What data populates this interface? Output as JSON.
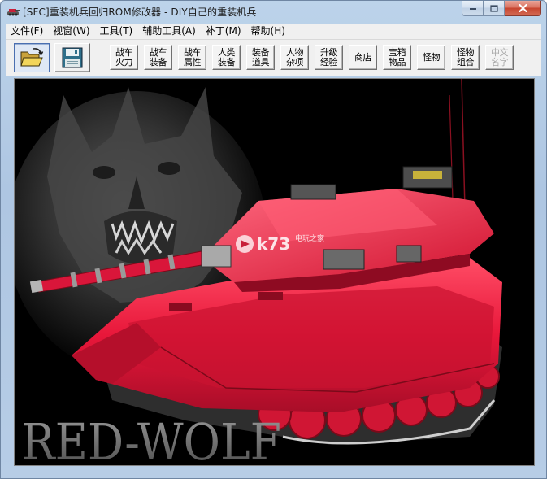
{
  "window": {
    "title": "[SFC]重装机兵回归ROM修改器 - DIY自己的重装机兵"
  },
  "menu": [
    {
      "label": "文件(F)"
    },
    {
      "label": "视窗(W)"
    },
    {
      "label": "工具(T)"
    },
    {
      "label": "辅助工具(A)"
    },
    {
      "label": "补丁(M)"
    },
    {
      "label": "帮助(H)"
    }
  ],
  "toolbar": {
    "open_icon": "folder-open-icon",
    "save_icon": "floppy-save-icon",
    "buttons": [
      {
        "line1": "战车",
        "line2": "火力",
        "enabled": true
      },
      {
        "line1": "战车",
        "line2": "装备",
        "enabled": true
      },
      {
        "line1": "战车",
        "line2": "属性",
        "enabled": true
      },
      {
        "line1": "人类",
        "line2": "装备",
        "enabled": true
      },
      {
        "line1": "装备",
        "line2": "道具",
        "enabled": true
      },
      {
        "line1": "人物",
        "line2": "杂项",
        "enabled": true
      },
      {
        "line1": "升级",
        "line2": "经验",
        "enabled": true
      },
      {
        "line1": "商店",
        "line2": "",
        "enabled": true
      },
      {
        "line1": "宝箱",
        "line2": "物品",
        "enabled": true
      },
      {
        "line1": "怪物",
        "line2": "",
        "enabled": true
      },
      {
        "line1": "怪物",
        "line2": "组合",
        "enabled": true
      },
      {
        "line1": "中文",
        "line2": "名字",
        "enabled": false
      }
    ]
  },
  "splash": {
    "logo_text": "RED-WOLF",
    "watermark_brand": "k73",
    "watermark_sub": "电玩之家",
    "colors": {
      "tank_red": "#e8173a",
      "background": "#000000"
    }
  }
}
